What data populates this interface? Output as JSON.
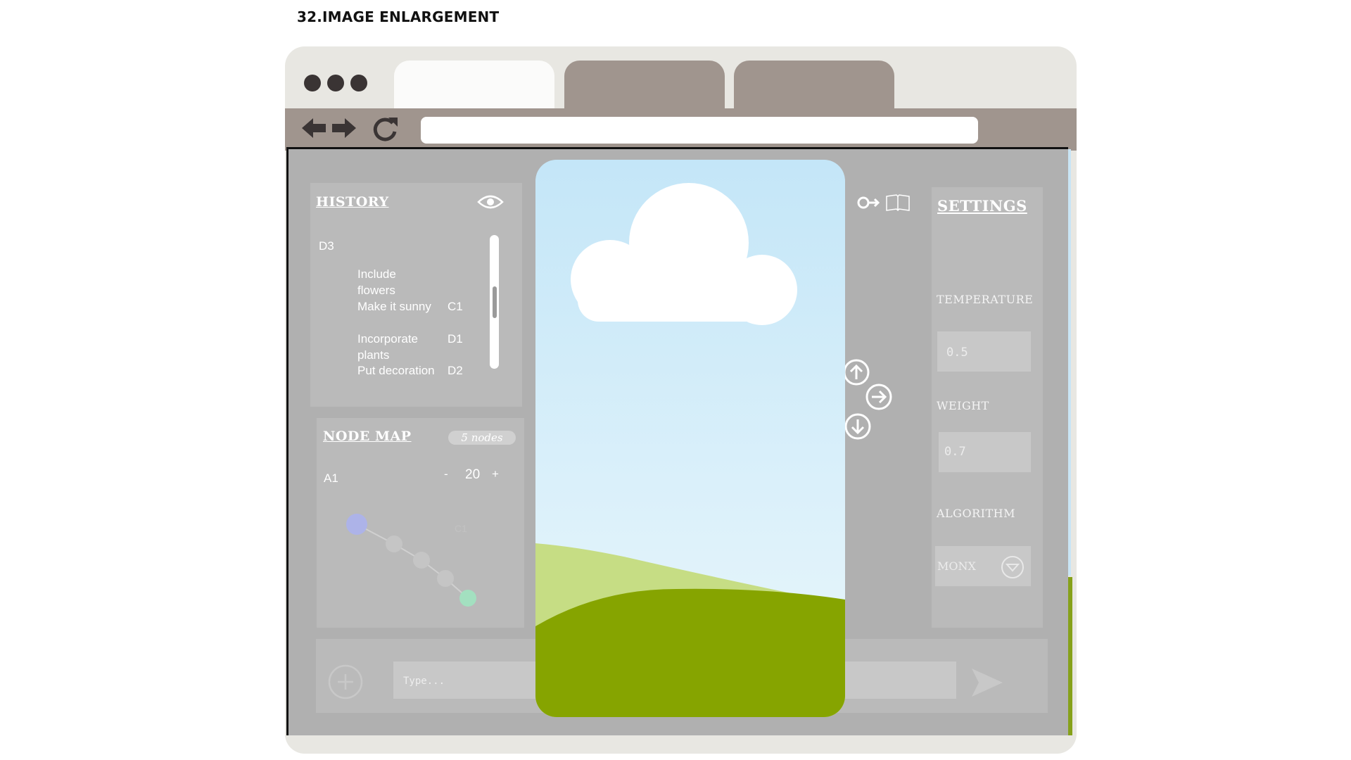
{
  "page_title": "32.IMAGE ENLARGEMENT",
  "browser": {
    "tabs": [
      "",
      "",
      ""
    ],
    "address": ""
  },
  "history": {
    "title": "HISTORY",
    "root": "D3",
    "items": [
      {
        "label": "Include flowers",
        "code": ""
      },
      {
        "label": "Make it sunny",
        "code": "C1"
      },
      {
        "label": "Incorporate plants",
        "code": "D1"
      },
      {
        "label": "Put decoration",
        "code": "D2"
      }
    ]
  },
  "node_map": {
    "title": "NODE MAP",
    "badge": "5 nodes",
    "node": "A1",
    "zoom_minus": "-",
    "zoom_value": "20",
    "zoom_plus": "+",
    "faded_label": "C1",
    "colors": {
      "start": "#adb3e8",
      "end": "#a3e0c0",
      "node": "#c5c5c5"
    }
  },
  "settings": {
    "title": "SETTINGS",
    "temperature_label": "TEMPERATURE",
    "temperature_value": "0.5",
    "weight_label": "WEIGHT",
    "weight_value": "0.7",
    "algorithm_label": "ALGORITHM",
    "algorithm_value": "MONX"
  },
  "chat": {
    "placeholder": "Type..."
  },
  "image_viewer": {
    "sky_top": "#c4e6f8",
    "sky_bottom": "#eaf7fb",
    "hill_light": "#c6dd84",
    "hill_dark": "#86a400"
  },
  "icons": [
    "back-arrow-icon",
    "forward-arrow-icon",
    "refresh-icon",
    "eye-icon",
    "key-icon",
    "book-icon",
    "arrow-up-icon",
    "arrow-right-icon",
    "arrow-down-icon",
    "plus-icon",
    "send-icon",
    "chevron-down-icon"
  ]
}
